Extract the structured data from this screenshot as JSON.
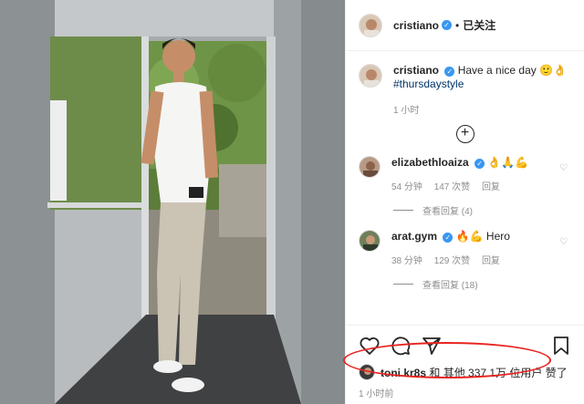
{
  "header": {
    "username": "cristiano",
    "verified_mark": "✓",
    "separator": "•",
    "follow_label": "已关注"
  },
  "caption": {
    "username": "cristiano",
    "text": "Have a nice day 🙂👌",
    "hashtag": "#thursdaystyle",
    "time": "1 小时"
  },
  "load_more": "+",
  "comments": [
    {
      "username": "elizabethloaiza",
      "text": "👌🙏💪",
      "time": "54 分钟",
      "likes": "147 次赞",
      "reply": "回复",
      "view_replies": "查看回复 (4)",
      "heart": "♡"
    },
    {
      "username": "arat.gym",
      "text": "🔥💪 Hero",
      "time": "38 分钟",
      "likes": "129 次赞",
      "reply": "回复",
      "view_replies": "查看回复 (18)",
      "heart": "♡"
    }
  ],
  "likes_line": {
    "user": "toni.kr8s",
    "rest": "和 其他 337.1万 位用户 赞了"
  },
  "posted_ago": "1 小时前",
  "icons": {
    "like": "heart-icon",
    "comment": "comment-icon",
    "share": "share-icon",
    "save": "bookmark-icon"
  },
  "colors": {
    "verified": "#3897f0",
    "hashtag": "#003569",
    "highlight": "#e8231f",
    "muted": "#8e8e8e"
  }
}
